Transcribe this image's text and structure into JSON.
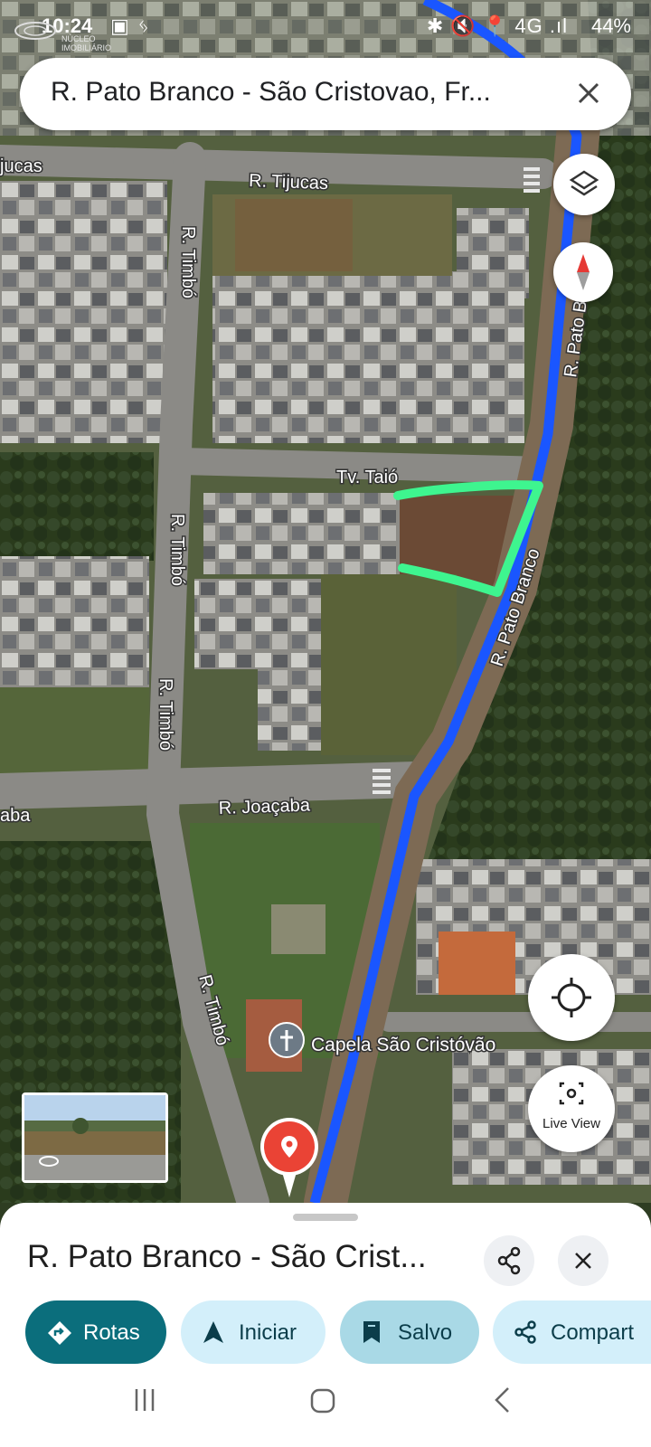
{
  "status_bar": {
    "time": "10:24",
    "right_icons": "✱ 🔇 📍 4G .ıl",
    "battery": "44%"
  },
  "watermark": {
    "line1": "NÚCLEO",
    "line2": "IMOBILIÁRIO"
  },
  "search": {
    "query": "R. Pato Branco - São Cristovao, Fr..."
  },
  "map": {
    "streets": {
      "tijucas_left": "jucas",
      "tijucas": "R. Tijucas",
      "timbo_1": "R. Timbó",
      "timbo_2": "R. Timbó",
      "timbo_3": "R. Timbó",
      "timbo_4": "R. Timbó",
      "taio": "Tv. Taió",
      "pato_branco_top": "R. Pato B",
      "pato_branco": "R. Pato Branco",
      "joacaba": "R. Joaçaba",
      "joacaba_left": "aba"
    },
    "poi": {
      "name": "Capela São Cristóvão"
    },
    "colors": {
      "route": "#1a56ff",
      "highlight": "#3ef58f",
      "pin": "#ea4335"
    }
  },
  "controls": {
    "live_view_label": "Live View"
  },
  "sheet": {
    "title": "R. Pato Branco - São Crist...",
    "chips": [
      {
        "label": "Rotas"
      },
      {
        "label": "Iniciar"
      },
      {
        "label": "Salvo"
      },
      {
        "label": "Compart"
      }
    ]
  },
  "colors": {
    "primary": "#0b6e7c",
    "chip_light": "#d3effa",
    "chip_saved": "#a9d9e6"
  }
}
